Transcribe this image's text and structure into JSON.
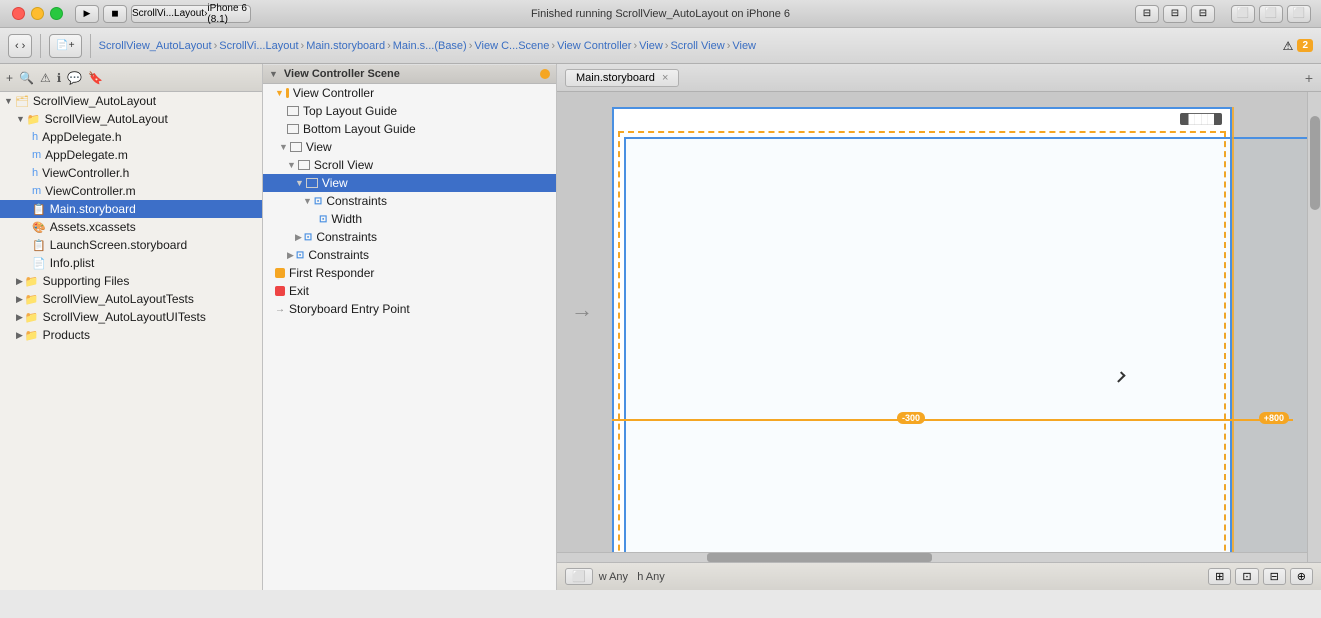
{
  "titlebar": {
    "title": "Main.storyboard",
    "app_name": "ScrollVi...Layout",
    "device": "iPhone 6 (8.1)",
    "status": "Finished running ScrollView_AutoLayout on iPhone 6"
  },
  "breadcrumb": {
    "items": [
      "ScrollView_AutoLayout",
      "ScrollVi...Layout",
      "Main.storyboard",
      "Main.s...(Base)",
      "View C...Scene",
      "View Controller",
      "View",
      "Scroll View",
      "View"
    ]
  },
  "warning": {
    "count": "2"
  },
  "navigator": {
    "items": [
      {
        "label": "ScrollView_AutoLayout",
        "level": 0,
        "type": "project",
        "expanded": true
      },
      {
        "label": "ScrollView_AutoLayout",
        "level": 1,
        "type": "group",
        "expanded": true
      },
      {
        "label": "AppDelegate.h",
        "level": 2,
        "type": "file"
      },
      {
        "label": "AppDelegate.m",
        "level": 2,
        "type": "file"
      },
      {
        "label": "ViewController.h",
        "level": 2,
        "type": "file"
      },
      {
        "label": "ViewController.m",
        "level": 2,
        "type": "file"
      },
      {
        "label": "Main.storyboard",
        "level": 2,
        "type": "storyboard",
        "selected": true
      },
      {
        "label": "Assets.xcassets",
        "level": 2,
        "type": "xcassets"
      },
      {
        "label": "LaunchScreen.storyboard",
        "level": 2,
        "type": "storyboard"
      },
      {
        "label": "Info.plist",
        "level": 2,
        "type": "plist"
      },
      {
        "label": "Supporting Files",
        "level": 1,
        "type": "group"
      },
      {
        "label": "ScrollView_AutoLayoutTests",
        "level": 1,
        "type": "group"
      },
      {
        "label": "ScrollView_AutoLayoutUITests",
        "level": 1,
        "type": "group"
      },
      {
        "label": "Products",
        "level": 1,
        "type": "group"
      }
    ]
  },
  "outline": {
    "scene_label": "View Controller Scene",
    "items": [
      {
        "label": "View Controller",
        "level": 0,
        "expanded": true,
        "icon": "orange-circle"
      },
      {
        "label": "Top Layout Guide",
        "level": 1,
        "icon": "square"
      },
      {
        "label": "Bottom Layout Guide",
        "level": 1,
        "icon": "square"
      },
      {
        "label": "View",
        "level": 1,
        "expanded": true,
        "icon": "square"
      },
      {
        "label": "Scroll View",
        "level": 2,
        "expanded": true,
        "icon": "square"
      },
      {
        "label": "View",
        "level": 3,
        "expanded": true,
        "icon": "square",
        "selected": true
      },
      {
        "label": "Constraints",
        "level": 4,
        "expanded": true,
        "icon": "constraint"
      },
      {
        "label": "Width",
        "level": 5,
        "icon": "constraint"
      },
      {
        "label": "Constraints",
        "level": 3,
        "expanded": false,
        "icon": "constraint"
      },
      {
        "label": "Constraints",
        "level": 2,
        "expanded": false,
        "icon": "constraint"
      },
      {
        "label": "First Responder",
        "level": 0,
        "icon": "orange-circle"
      },
      {
        "label": "Exit",
        "level": 0,
        "icon": "exit"
      },
      {
        "label": "Storyboard Entry Point",
        "level": 0,
        "icon": "arrow"
      }
    ]
  },
  "canvas": {
    "tab_label": "Main.storyboard",
    "constraint_left": "-300",
    "constraint_right": "+800",
    "status_width": "w Any",
    "status_height": "h Any"
  },
  "icons": {
    "play": "▶",
    "stop": "◼",
    "back": "‹",
    "forward": "›",
    "warning": "⚠",
    "add": "+",
    "search": "🔍",
    "folder": "📁",
    "file": "📄"
  }
}
